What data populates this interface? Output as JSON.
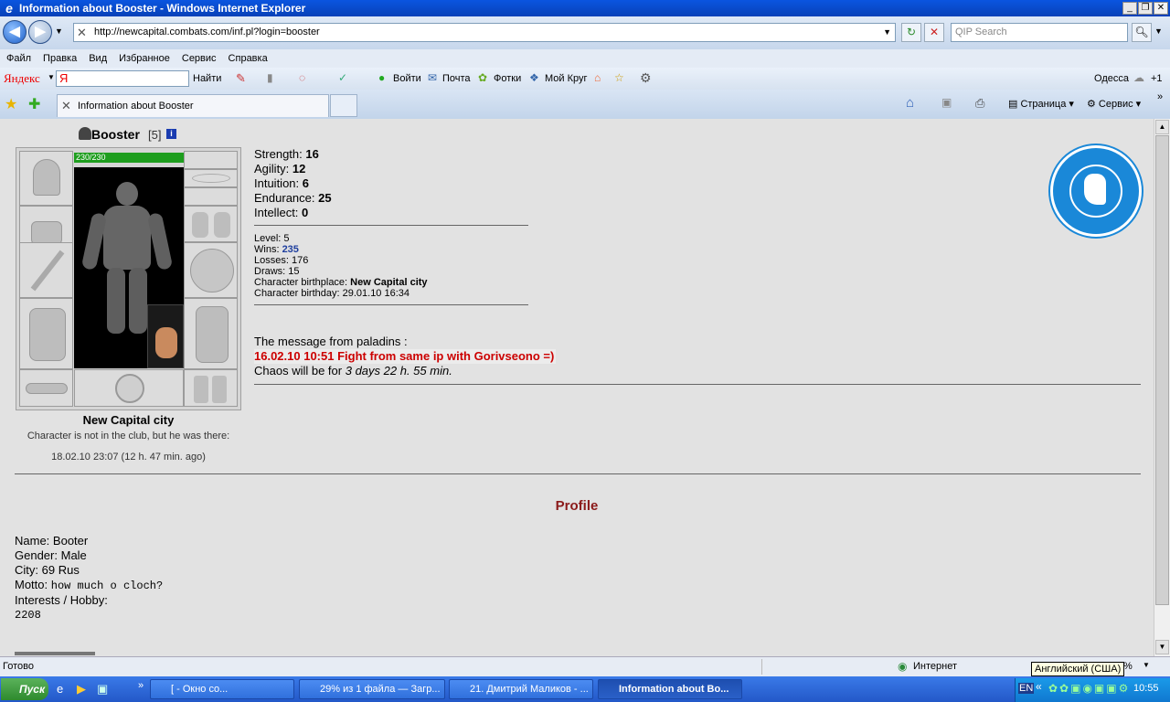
{
  "window": {
    "title": "Information about Booster - Windows Internet Explorer",
    "ie_icon": "ie-icon"
  },
  "address": {
    "url": "http://newcapital.combats.com/inf.pl?login=booster",
    "search_placeholder": "QIP Search"
  },
  "menu": [
    "Файл",
    "Правка",
    "Вид",
    "Избранное",
    "Сервис",
    "Справка"
  ],
  "yandex": {
    "brand": "Яндекс",
    "input_value": "Я",
    "find": "Найти",
    "login": "Войти",
    "mail": "Почта",
    "photos": "Фотки",
    "circle": "Мой Круг",
    "city": "Одесса",
    "temp": "+1"
  },
  "tab": {
    "label": "Information about Booster"
  },
  "cmdbar": {
    "page": "Страница",
    "service": "Сервис"
  },
  "char": {
    "name": "Booster",
    "level_tag": "[5]",
    "hp": "230/230",
    "city": "New Capital city",
    "club_note": "Character is not in the club, but he was there:",
    "last_seen": "18.02.10 23:07 (12 h. 47 min. ago)"
  },
  "stats": [
    {
      "label": "Strength:",
      "value": "16"
    },
    {
      "label": "Agility:",
      "value": "12"
    },
    {
      "label": "Intuition:",
      "value": "6"
    },
    {
      "label": "Endurance:",
      "value": "25"
    },
    {
      "label": "Intellect:",
      "value": "0"
    }
  ],
  "info": {
    "level_label": "Level:",
    "level": "5",
    "wins_label": "Wins:",
    "wins": "235",
    "losses_label": "Losses:",
    "losses": "176",
    "draws_label": "Draws:",
    "draws": "15",
    "birthplace_label": "Character birthplace:",
    "birthplace": "New Capital city",
    "birthday_label": "Character birthday:",
    "birthday": "29.01.10 16:34"
  },
  "paladins": {
    "heading": "The message from paladins :",
    "message": "16.02.10 10:51 Fight from same ip with Gorivseono =)",
    "chaos_prefix": "Chaos will be for",
    "chaos_time": "3 days 22 h. 55 min."
  },
  "profile": {
    "title": "Profile",
    "name_label": "Name:",
    "name": "Booter",
    "gender_label": "Gender:",
    "gender": "Male",
    "city_label": "City:",
    "city": "69 Rus",
    "motto_label": "Motto:",
    "motto": "how much o cloch?",
    "hobby_label": "Interests / Hobby:",
    "hobby": "2208"
  },
  "status": {
    "text": "Готово",
    "zone": "Интернет",
    "tooltip": "Английский (США)",
    "zoom_tail": "%"
  },
  "taskbar": {
    "start": "Пуск",
    "tasks": [
      "[             - Окно co...",
      "29% из 1 файла — Загр...",
      "21. Дмитрий Маликов - ...",
      "Information about Bo..."
    ],
    "lang": "EN",
    "clock": "10:55"
  },
  "colors": {
    "red": "#cc0000",
    "profile": "#8b1a1a",
    "wins": "#1f3f9e",
    "content_bg": "#e2e2e2"
  }
}
